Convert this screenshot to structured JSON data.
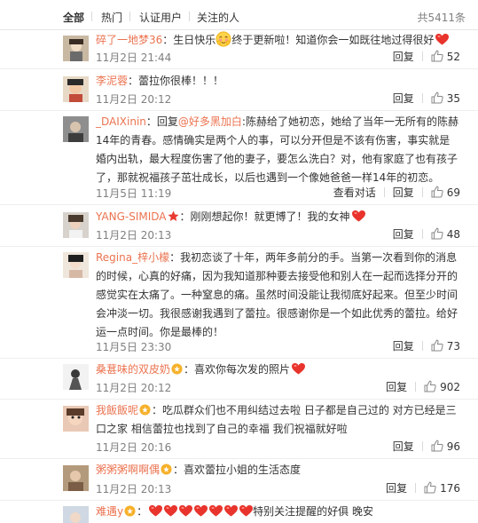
{
  "tabs": [
    {
      "label": "全部"
    },
    {
      "label": "热门"
    },
    {
      "label": "认证用户"
    },
    {
      "label": "关注的人"
    }
  ],
  "total": "共5411条",
  "actions": {
    "reply": "回复",
    "view_conversation": "查看对话"
  },
  "comments": [
    {
      "user": "碎了一地梦36",
      "sep": "：",
      "text_a": "生日快乐",
      "text_b": "终于更新啦！知道你会一如既往地过得很好",
      "time": "11月2日 21:44",
      "likes": "52"
    },
    {
      "user": "李泥蓉",
      "sep": "：",
      "text": "蕾拉你很棒！！！",
      "time": "11月2日 20:12",
      "likes": "35"
    },
    {
      "user": "_DAIXinin",
      "sep": "：回复",
      "mention": "@好多黑加白",
      "text": ":陈赫给了她初恋，她给了当年一无所有的陈赫14年的青春。感情确实是两个人的事，可以分开但是不该有伤害，事实就是婚内出轨，最大程度伤害了他的妻子，要怎么洗白？对，他有家庭了也有孩子了，那就祝福孩子茁壮成长，以后也遇到一个像她爸爸一样14年的初恋。",
      "time": "11月5日 11:19",
      "likes": "69"
    },
    {
      "user": "YANG-SIMIDA",
      "sep": "：",
      "text": "刚刚想起你！就更博了！我的女神",
      "time": "11月2日 20:13",
      "likes": "48"
    },
    {
      "user": "Regina_梓小檬",
      "sep": "：",
      "text": "我初恋谈了十年，两年多前分的手。当第一次看到你的消息的时候，心真的好痛，因为我知道那种要去接受他和别人在一起而选择分开的感觉实在太痛了。一种窒息的痛。虽然时间没能让我彻底好起来。但至少时间会冲淡一切。我很感谢我遇到了蕾拉。很感谢你是一个如此优秀的蕾拉。给好运一点时间。你是最棒的！",
      "time": "11月5日 23:30",
      "likes": "73"
    },
    {
      "user": "桑葚味的双皮奶",
      "sep": "：",
      "text": "喜欢你每次发的照片",
      "time": "11月2日 20:12",
      "likes": "902"
    },
    {
      "user": "我飯飯呢",
      "sep": "：",
      "text": "吃瓜群众们也不用纠结过去啦 日子都是自己过的 对方已经是三口之家 相信蕾拉也找到了自己的幸福 我们祝福就好啦",
      "time": "11月2日 20:16",
      "likes": "96"
    },
    {
      "user": "粥粥粥啊啊偶",
      "sep": "：",
      "text": "喜欢蕾拉小姐的生活态度",
      "time": "11月2日 20:13",
      "likes": "176"
    },
    {
      "user": "难遇y",
      "sep": "：",
      "text": "特别关注提醒的好俱 晚安",
      "time": "",
      "likes": ""
    }
  ],
  "colors": {
    "link": "#eb7350",
    "text": "#333333",
    "muted": "#808080",
    "heart": "#e8342c"
  },
  "icons": [
    "heart-emoji",
    "shy-face-emoji",
    "thumb-up-icon",
    "fan-badge-icon",
    "star-badge-icon"
  ]
}
